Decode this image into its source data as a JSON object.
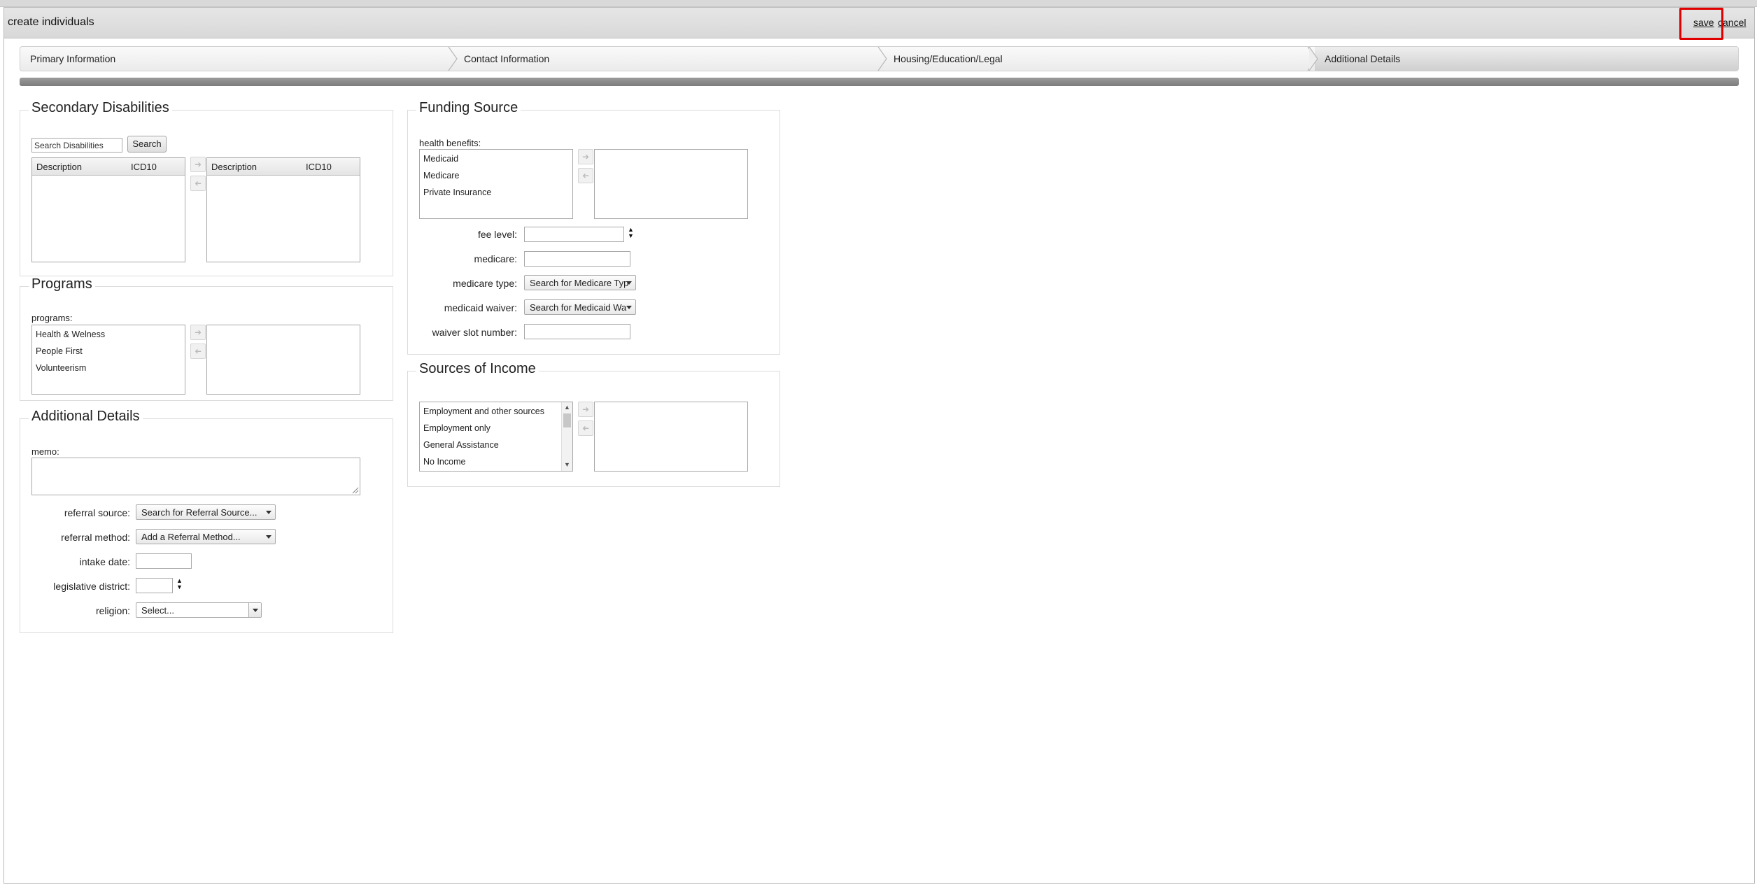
{
  "dialog": {
    "title": "create individuals",
    "save_label": "save",
    "cancel_label": "cancel"
  },
  "wizard": {
    "steps": [
      {
        "label": "Primary Information"
      },
      {
        "label": "Contact Information"
      },
      {
        "label": "Housing/Education/Legal"
      },
      {
        "label": "Additional Details"
      }
    ],
    "active_step": "Additional Details"
  },
  "secondary_disabilities": {
    "legend": "Secondary Disabilities",
    "search_value": "Search Disabilities",
    "search_button": "Search",
    "col_description": "Description",
    "col_icd10": "ICD10"
  },
  "programs": {
    "legend": "Programs",
    "label": "programs:",
    "items": [
      "Health & Welness",
      "People First",
      "Volunteerism"
    ]
  },
  "additional_details": {
    "legend": "Additional Details",
    "memo_label": "memo:",
    "referral_source_label": "referral source:",
    "referral_source_value": "Search for Referral Source...",
    "referral_method_label": "referral method:",
    "referral_method_value": "Add a Referral Method...",
    "intake_date_label": "intake date:",
    "legislative_district_label": "legislative district:",
    "religion_label": "religion:",
    "religion_value": "Select..."
  },
  "funding_source": {
    "legend": "Funding Source",
    "health_benefits_label": "health benefits:",
    "health_benefits": [
      "Medicaid",
      "Medicare",
      "Private Insurance"
    ],
    "fee_level_label": "fee level:",
    "medicare_label": "medicare:",
    "medicare_type_label": "medicare type:",
    "medicare_type_value": "Search for Medicare Typ",
    "medicaid_waiver_label": "medicaid waiver:",
    "medicaid_waiver_value": "Search for Medicaid Wa",
    "waiver_slot_label": "waiver slot number:"
  },
  "sources_of_income": {
    "legend": "Sources of Income",
    "items": [
      "Employment and other sources",
      "Employment only",
      "General Assistance",
      "No Income"
    ]
  },
  "icons": {
    "move_right": "arrow-right-icon",
    "move_left": "arrow-left-icon",
    "dropdown": "chevron-down-icon",
    "spinner": "spinner-arrows-icon"
  },
  "colors": {
    "highlight": "#e00000",
    "progress": "#8a8a8a"
  }
}
